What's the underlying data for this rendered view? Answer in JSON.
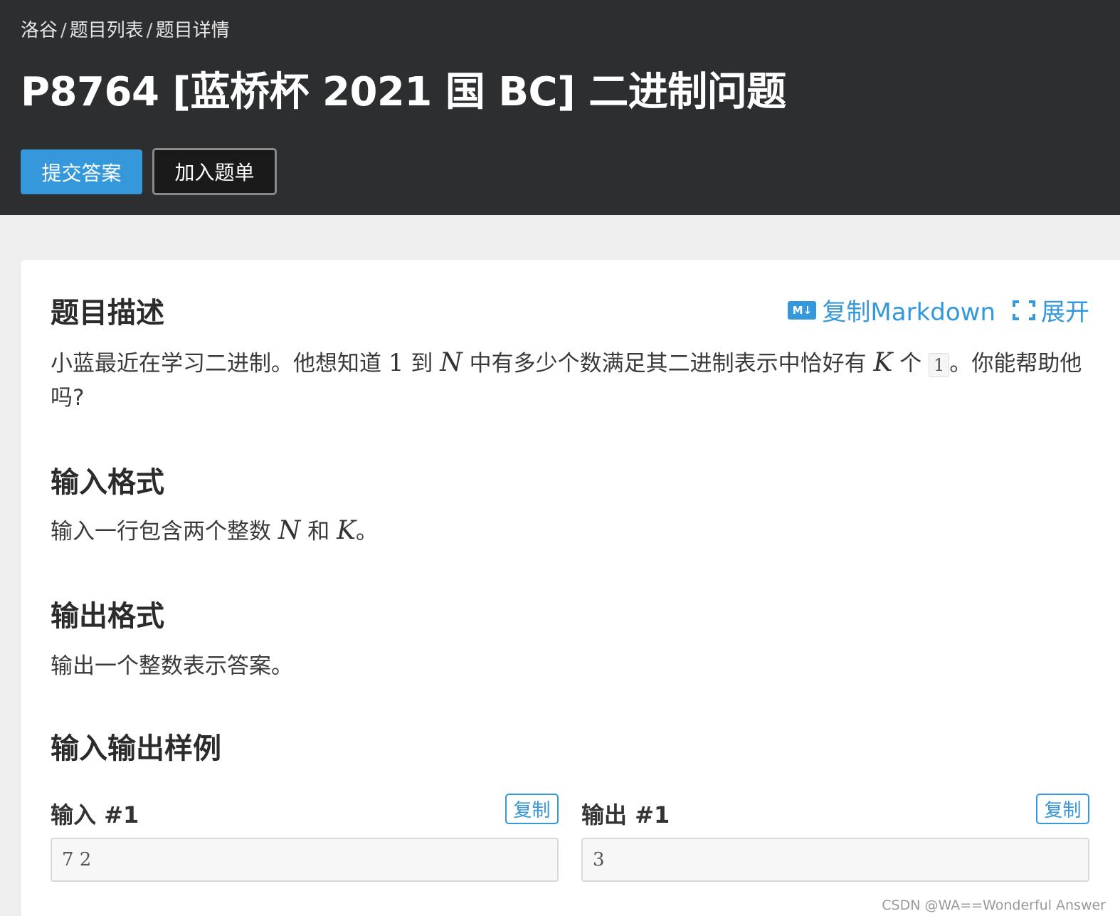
{
  "breadcrumb": {
    "items": [
      "洛谷",
      "题目列表",
      "题目详情"
    ],
    "separator": "/"
  },
  "title": "P8764 [蓝桥杯 2021 国 BC] 二进制问题",
  "buttons": {
    "submit": "提交答案",
    "add_to_list": "加入题单"
  },
  "actions": {
    "md_icon": "M↓",
    "copy_markdown": "复制Markdown",
    "expand": "展开"
  },
  "description": {
    "heading": "题目描述",
    "p1": "小蓝最近在学习二进制。他想知道",
    "one": "1",
    "p2": "到",
    "N": "N",
    "p3": "中有多少个数满足其二进制表示中恰好有",
    "K": "K",
    "p4": "个",
    "code_one": "1",
    "p5": "。你能帮助他吗?"
  },
  "input_format": {
    "heading": "输入格式",
    "p1": "输入一行包含两个整数",
    "N": "N",
    "p2": "和",
    "K": "K",
    "p3": "。"
  },
  "output_format": {
    "heading": "输出格式",
    "text": "输出一个整数表示答案。"
  },
  "samples": {
    "heading": "输入输出样例",
    "input_label": "输入 #1",
    "output_label": "输出 #1",
    "copy_label": "复制",
    "input_value": "7 2",
    "output_value": "3"
  },
  "watermark": "CSDN @WA==Wonderful Answer",
  "colors": {
    "header_bg": "#2d2e30",
    "accent": "#3498db",
    "page_bg": "#efefef"
  }
}
